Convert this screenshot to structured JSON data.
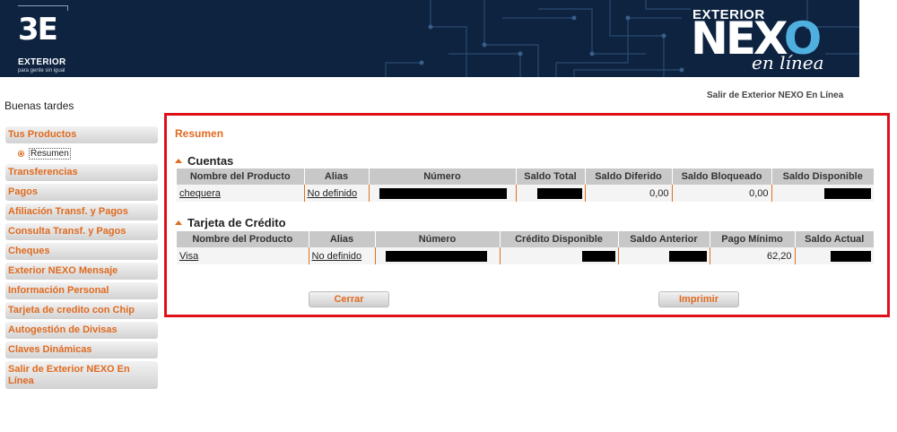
{
  "header": {
    "bank_logo_mark": "3E",
    "bank_name": "EXTERIOR",
    "bank_tagline": "para gente sin igual",
    "product_brand_top": "EXTERIOR",
    "product_brand_main_a": "NEX",
    "product_brand_main_b": "O",
    "product_brand_sub": "en línea"
  },
  "greeting": "Buenas tardes",
  "logout_top": "Salir de Exterior NEXO En Línea",
  "sidebar": {
    "items": [
      {
        "label": "Tus Productos"
      },
      {
        "label": "Transferencias"
      },
      {
        "label": "Pagos"
      },
      {
        "label": "Afiliación Transf. y Pagos"
      },
      {
        "label": "Consulta Transf. y Pagos"
      },
      {
        "label": "Cheques"
      },
      {
        "label": "Exterior NEXO Mensaje"
      },
      {
        "label": "Información Personal"
      },
      {
        "label": "Tarjeta de credito con Chip"
      },
      {
        "label": "Autogestión de Divisas"
      },
      {
        "label": "Claves Dinámicas"
      },
      {
        "label": "Salir de Exterior NEXO En Línea"
      }
    ],
    "sub_item": "Resumen"
  },
  "panel": {
    "title": "Resumen",
    "cuentas": {
      "title": "Cuentas",
      "headers": [
        "Nombre del Producto",
        "Alias",
        "Número",
        "Saldo Total",
        "Saldo Diferido",
        "Saldo Bloqueado",
        "Saldo Disponible"
      ],
      "rows": [
        {
          "product": "chequera",
          "alias": "No definido",
          "numero": "",
          "saldo_total": "",
          "saldo_diferido": "0,00",
          "saldo_bloqueado": "0,00",
          "saldo_disponible": ""
        }
      ]
    },
    "tarjeta": {
      "title": "Tarjeta de Crédito",
      "headers": [
        "Nombre del Producto",
        "Alias",
        "Número",
        "Crédito Disponible",
        "Saldo Anterior",
        "Pago Mínimo",
        "Saldo Actual"
      ],
      "rows": [
        {
          "product": "Visa",
          "alias": "No definido",
          "numero": "",
          "credito_disponible": "",
          "saldo_anterior": "",
          "pago_minimo": "62,20",
          "saldo_actual": ""
        }
      ]
    },
    "buttons": {
      "close": "Cerrar",
      "print": "Imprimir"
    }
  },
  "colors": {
    "accent": "#e06a1f",
    "highlight_border": "#e0101a",
    "banner": "#0d2340"
  }
}
